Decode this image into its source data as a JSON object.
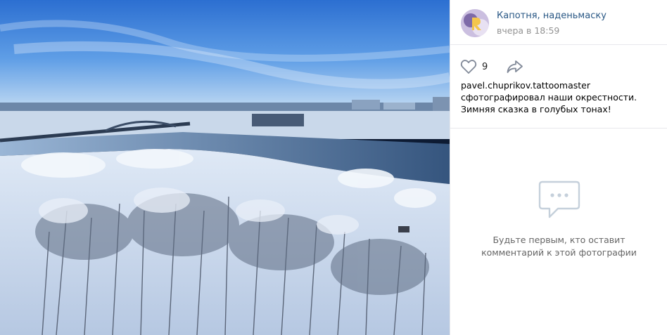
{
  "post": {
    "author": "Капотня, наденьмаску",
    "date": "вчера в 18:59",
    "likes": "9",
    "caption_mention": "pavel.chuprikov.tattoomaster",
    "caption_text": "сфотографировал наши окрестности. Зимняя сказка в голубых тонах!"
  },
  "comments": {
    "empty_line1": "Будьте первым, кто оставит",
    "empty_line2": "комментарий к этой фотографии"
  },
  "icons": {
    "like": "heart-icon",
    "share": "share-arrow-icon",
    "comments": "speech-bubble-icon"
  },
  "colors": {
    "link": "#2a5885",
    "meta": "#939393",
    "muted": "#656565",
    "border": "#e7e8ec"
  }
}
